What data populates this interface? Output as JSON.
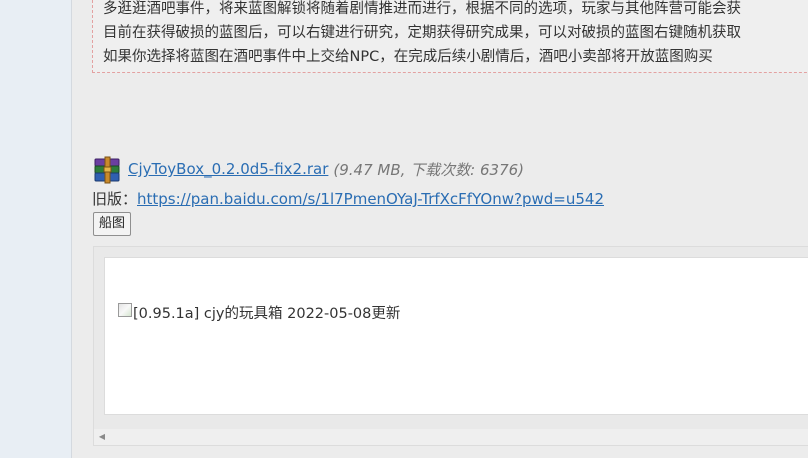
{
  "notice": {
    "lines": [
      "多逛逛酒吧事件，将来蓝图解锁将随着剧情推进而进行，根据不同的选项，玩家与其他阵营可能会获",
      "目前在获得破损的蓝图后，可以右键进行研究，定期获得研究成果，可以对破损的蓝图右键随机获取",
      "如果你选择将蓝图在酒吧事件中上交给NPC，在完成后续小剧情后，酒吧小卖部将开放蓝图购买"
    ]
  },
  "attachment": {
    "icon": "winrar-archive-icon",
    "filename": "CjyToyBox_0.2.0d5-fix2.rar",
    "meta": "(9.47 MB, 下载次数: 6376)"
  },
  "old_version": {
    "label": "旧版：",
    "url": "https://pan.baidu.com/s/1l7PmenOYaJ-TrfXcFfYOnw?pwd=u542"
  },
  "ship_button": {
    "label": "船图"
  },
  "embed": {
    "image_alt": "[0.95.1a] cjy的玩具箱 2022-05-08更新",
    "scroll_left_icon": "triangle-left-icon"
  },
  "colors": {
    "link": "#2a6db3",
    "notice_border": "#e3a1a1",
    "page_bg": "#ececec",
    "left_rail": "#e8eef4"
  }
}
